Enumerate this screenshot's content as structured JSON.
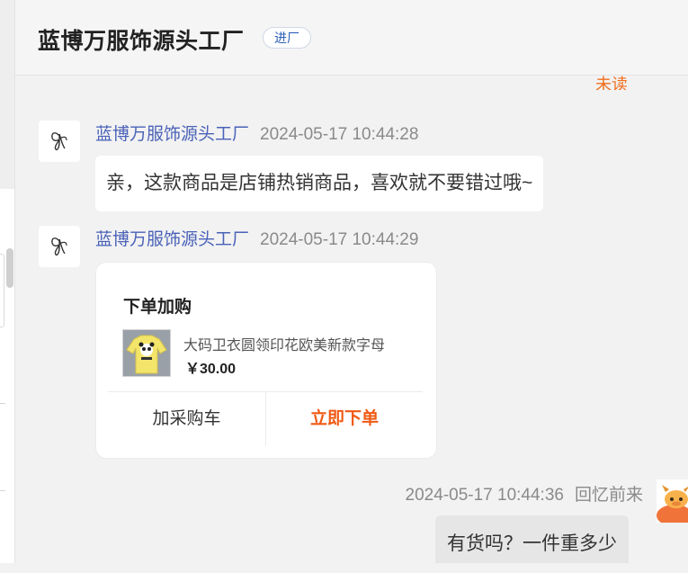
{
  "shop": {
    "name": "蓝博万服饰源头工厂",
    "tag": "进厂"
  },
  "status": {
    "unread": "未读"
  },
  "messages": [
    {
      "sender": "蓝博万服饰源头工厂",
      "time": "2024-05-17 10:44:28",
      "text": "亲，这款商品是店铺热销商品，喜欢就不要错过哦~"
    },
    {
      "sender": "蓝博万服饰源头工厂",
      "time": "2024-05-17 10:44:29",
      "card": {
        "title": "下单加购",
        "product_name": "大码卫衣圆领印花欧美新款字母",
        "price": "￥30.00",
        "add_cart_label": "加采购车",
        "buy_now_label": "立即下单"
      }
    },
    {
      "sender": "回忆前来",
      "time": "2024-05-17 10:44:36",
      "text": "有货吗？一件重多少"
    }
  ],
  "colors": {
    "accent_orange": "#f05a14",
    "sender_blue": "#4a62b8",
    "unread_orange": "#f06e1d",
    "outgoing_bubble": "#e6e6e6"
  },
  "icons": {
    "shop_avatar": "butterfly-logo-icon",
    "user_avatar": "cartoon-avatar-icon"
  }
}
